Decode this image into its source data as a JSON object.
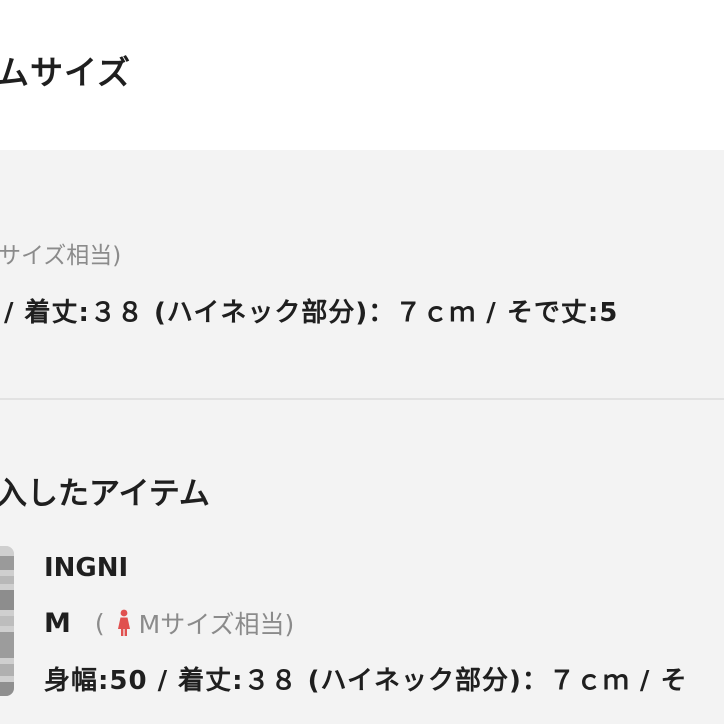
{
  "header": {
    "title": "ムサイズ"
  },
  "item_top": {
    "size_note": "サイズ相当)",
    "measurements": "/ 着丈:３８ (ハイネック部分)：７ｃｍ / そで丈:5"
  },
  "section": {
    "title": "入したアイテム"
  },
  "item": {
    "brand": "INGNI",
    "size": "M",
    "equiv_open": "(",
    "equiv_label": "Mサイズ相当)",
    "measurements": "身幅:50 / 着丈:３８ (ハイネック部分)：７ｃｍ / そ",
    "icon": "female-person-icon",
    "icon_color": "#e0504f"
  }
}
